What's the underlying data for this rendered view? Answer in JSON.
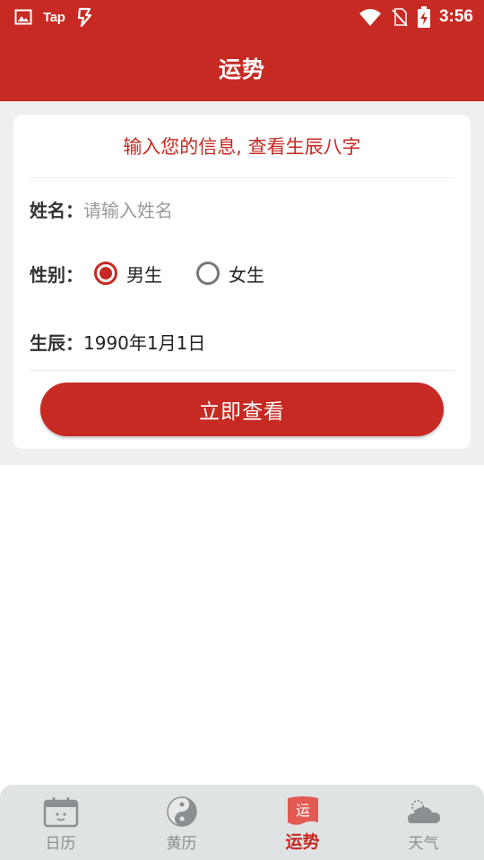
{
  "status_bar": {
    "app_label": "Tap",
    "time": "3:56"
  },
  "app_bar": {
    "title": "运势"
  },
  "form": {
    "heading": "输入您的信息, 查看生辰八字",
    "name_label": "姓名：",
    "name_placeholder": "请输入姓名",
    "gender_label": "性别：",
    "gender_options": [
      {
        "label": "男生",
        "selected": true
      },
      {
        "label": "女生",
        "selected": false
      }
    ],
    "birth_label": "生辰：",
    "birth_value": "1990年1月1日",
    "submit_label": "立即查看"
  },
  "bottom_nav": {
    "items": [
      {
        "label": "日历",
        "icon": "calendar-icon",
        "active": false
      },
      {
        "label": "黄历",
        "icon": "yin-yang-icon",
        "active": false
      },
      {
        "label": "运势",
        "icon": "fortune-flag-icon",
        "icon_text": "运",
        "active": true
      },
      {
        "label": "天气",
        "icon": "weather-cloud-icon",
        "active": false
      }
    ]
  },
  "colors": {
    "brand_red": "#c62a22",
    "inactive_gray": "#8a8f91",
    "background_gray": "#efefef"
  }
}
